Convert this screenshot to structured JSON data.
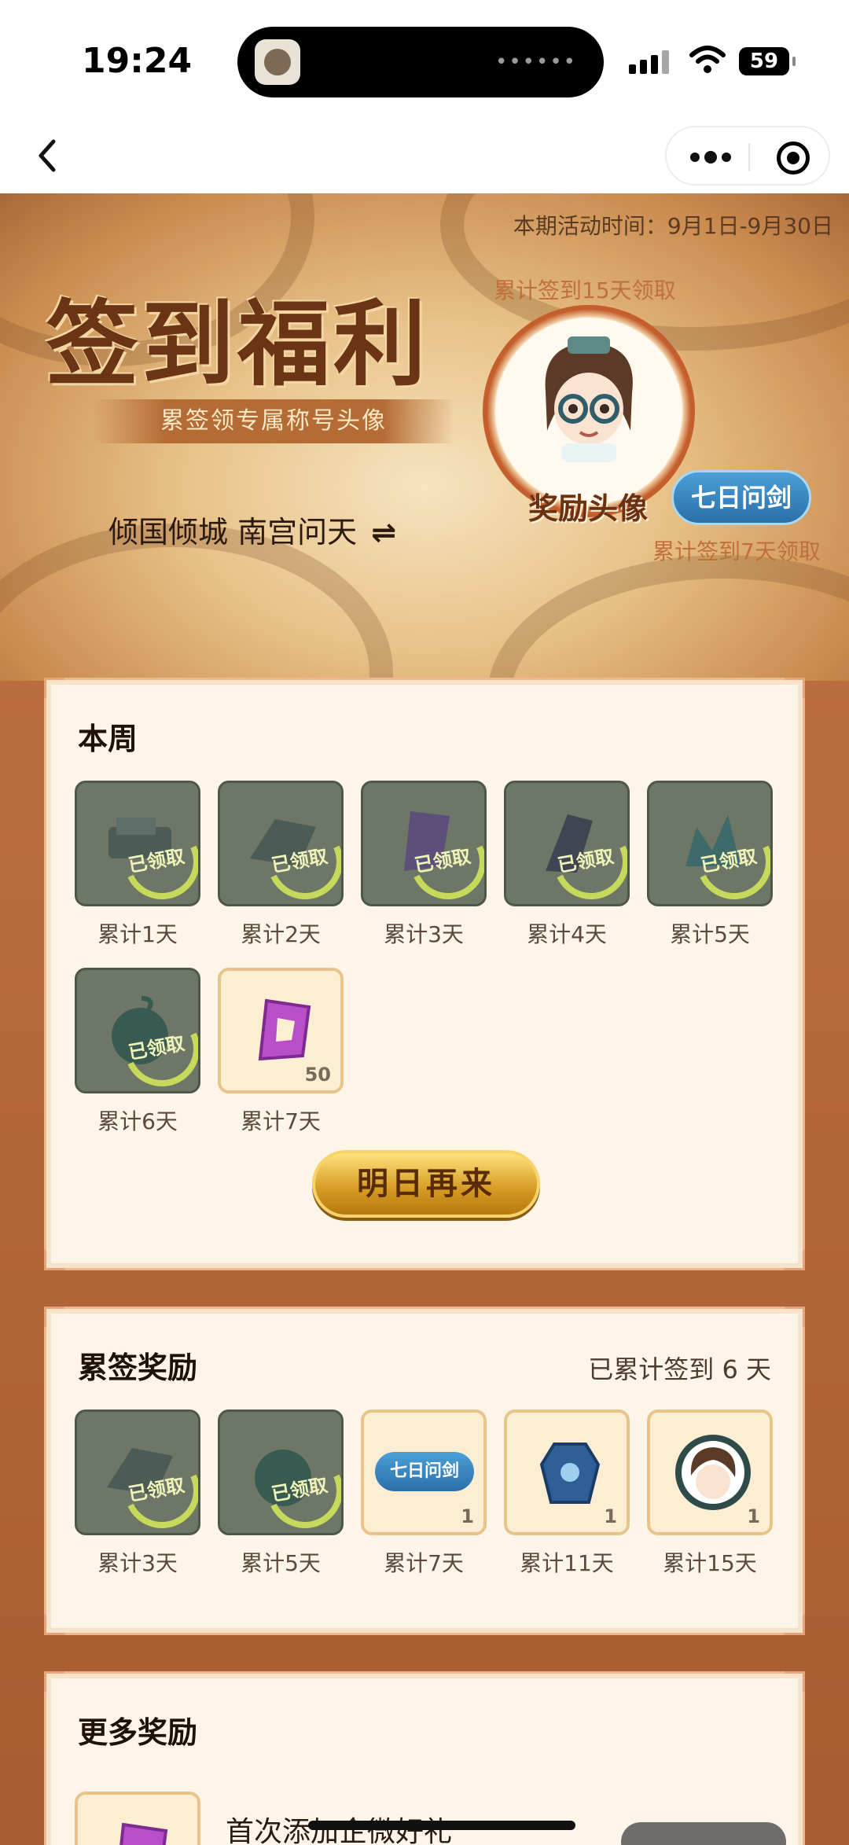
{
  "status_bar": {
    "time": "19:24",
    "battery": "59"
  },
  "banner": {
    "period": "本期活动时间：9月1日-9月30日",
    "title": "签到福利",
    "subtitle": "累签领专属称号头像",
    "user_line": "倾国倾城 南宫问天",
    "swap_symbol": "⇌",
    "cum15": "累计签到15天领取",
    "avatar_label": "奖励头像",
    "badge_text": "七日问剑",
    "cum7": "累计签到7天领取"
  },
  "week": {
    "title": "本周",
    "claimed_text": "已领取",
    "items": [
      {
        "label": "累计1天",
        "claimed": true,
        "icon": "scroll-icon"
      },
      {
        "label": "累计2天",
        "claimed": true,
        "icon": "scroll-icon"
      },
      {
        "label": "累计3天",
        "claimed": true,
        "icon": "crystal-icon"
      },
      {
        "label": "累计4天",
        "claimed": true,
        "icon": "stone-icon"
      },
      {
        "label": "累计5天",
        "claimed": true,
        "icon": "jade-icon"
      },
      {
        "label": "累计6天",
        "claimed": true,
        "icon": "gourd-icon"
      },
      {
        "label": "累计7天",
        "claimed": false,
        "icon": "crystal-icon",
        "count": "50"
      }
    ],
    "button": "明日再来"
  },
  "cumulative": {
    "title": "累签奖励",
    "progress_text": "已累计签到 6 天",
    "items": [
      {
        "label": "累计3天",
        "claimed": true
      },
      {
        "label": "累计5天",
        "claimed": true
      },
      {
        "label": "累计7天",
        "claimed": false,
        "badge": "七日问剑",
        "count": "1"
      },
      {
        "label": "累计11天",
        "claimed": false,
        "count": "1"
      },
      {
        "label": "累计15天",
        "claimed": false,
        "count": "1"
      }
    ]
  },
  "more": {
    "title": "更多奖励",
    "first_item_text": "首次添加企微好礼"
  },
  "colors": {
    "accent": "#c45e2c",
    "card_bg": "#fdf5e8",
    "claimed_green": "#c7d95a"
  }
}
